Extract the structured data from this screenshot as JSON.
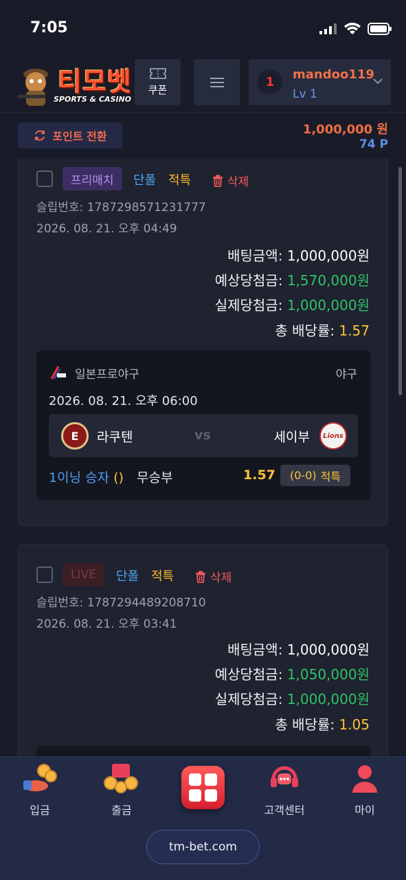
{
  "status_bar": {
    "time": "7:05"
  },
  "header": {
    "logo_text": "티모벳",
    "logo_sub": "SPORTS & CASINO",
    "coupon_label": "쿠폰",
    "user": {
      "avatar_text": "1",
      "username": "mandoo119",
      "level": "Lv 1"
    }
  },
  "wallet": {
    "point_convert_label": "포인트 전환",
    "balance": "1,000,000 원",
    "points": "74 P"
  },
  "bets": [
    {
      "type_tag": "프리매치",
      "bet_kind": "단폴",
      "result": "적특",
      "delete_label": "삭제",
      "slip_no": "슬립번호: 1787298571231777",
      "slip_date": "2026. 08. 21. 오후 04:49",
      "bet_amount_label": "배팅금액:",
      "bet_amount": "1,000,000원",
      "expected_win_label": "예상당첨금:",
      "expected_win": "1,570,000원",
      "actual_win_label": "실제당첨금:",
      "actual_win": "1,000,000원",
      "total_odds_label": "총 배당률:",
      "total_odds": "1.57",
      "game": {
        "league": "일본프로야구",
        "sport": "야구",
        "date": "2026. 08. 21. 오후 06:00",
        "home": "라쿠텐",
        "vs": "vs",
        "away": "세이부",
        "market": "1이닝 승자",
        "market_paren": "()",
        "pick": "무승부",
        "odds": "1.57",
        "score": "(0-0)",
        "status": "적특"
      }
    },
    {
      "type_tag": "LIVE",
      "bet_kind": "단폴",
      "result": "적특",
      "delete_label": "삭제",
      "slip_no": "슬립번호: 1787294489208710",
      "slip_date": "2026. 08. 21. 오후 03:41",
      "bet_amount_label": "배팅금액:",
      "bet_amount": "1,000,000원",
      "expected_win_label": "예상당첨금:",
      "expected_win": "1,050,000원",
      "actual_win_label": "실제당첨금:",
      "actual_win": "1,000,000원",
      "total_odds_label": "총 배당률:",
      "total_odds": "1.05"
    }
  ],
  "tabbar": {
    "deposit": "입금",
    "withdraw": "출금",
    "support": "고객센터",
    "my": "마이",
    "url": "tm-bet.com"
  },
  "icons": [
    "signal-icon",
    "wifi-icon",
    "battery-icon",
    "ticket-icon",
    "hamburger-icon",
    "chevron-down-icon",
    "refresh-icon",
    "trash-icon",
    "npb-icon",
    "menu-grid-icon"
  ]
}
